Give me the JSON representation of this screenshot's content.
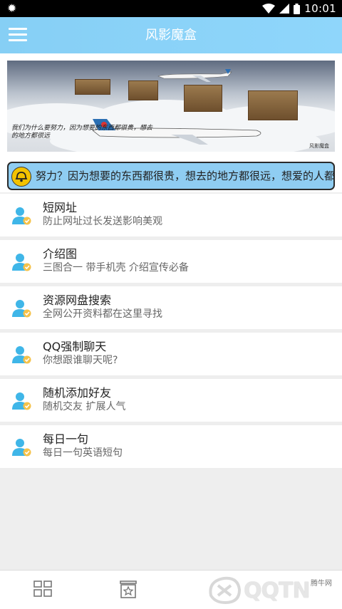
{
  "status_bar": {
    "time": "10:01"
  },
  "app_bar": {
    "title": "风影魔盒"
  },
  "banner": {
    "caption": "我们为什么要努力，因为想要的东西都很贵，想去的地方都很远",
    "watermark": "风影魔盒"
  },
  "notice": {
    "text": "努力？因为想要的东西都很贵，想去的地方都很远，想爱的人都很优秀"
  },
  "menu_items": [
    {
      "title": "短网址",
      "subtitle": "防止网址过长发送影响美观"
    },
    {
      "title": "介绍图",
      "subtitle": "三图合一 带手机壳 介绍宣传必备"
    },
    {
      "title": "资源网盘搜索",
      "subtitle": "全网公开资料都在这里寻找"
    },
    {
      "title": "QQ强制聊天",
      "subtitle": "你想跟谁聊天呢?"
    },
    {
      "title": "随机添加好友",
      "subtitle": "随机交友 扩展人气"
    },
    {
      "title": "每日一句",
      "subtitle": "每日一句英语短句"
    }
  ],
  "watermark": {
    "logo_text": "QQTN",
    "site_label": "腾牛网"
  },
  "colors": {
    "app_bar": "#8fd6fb",
    "notice_bg": "#8fcdf2",
    "person_icon": "#3fb6e8",
    "badge": "#f5c24a"
  }
}
